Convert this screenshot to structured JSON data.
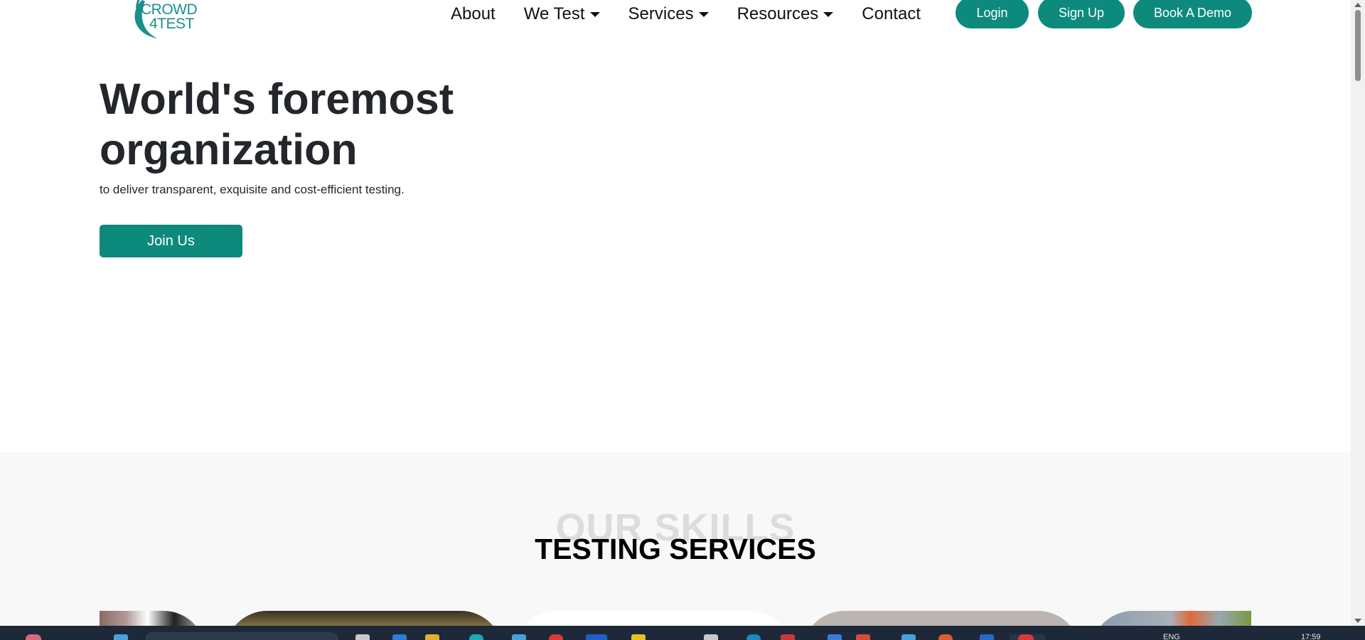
{
  "header": {
    "logo_line1": "CROWD",
    "logo_line2": "4TEST",
    "nav": [
      {
        "label": "About",
        "dropdown": false
      },
      {
        "label": "We Test",
        "dropdown": true
      },
      {
        "label": "Services",
        "dropdown": true
      },
      {
        "label": "Resources",
        "dropdown": true
      },
      {
        "label": "Contact",
        "dropdown": false
      }
    ],
    "login_label": "Login",
    "signup_label": "Sign Up",
    "demo_label": "Book A Demo"
  },
  "hero": {
    "title": "World's foremost organization",
    "subtitle": "to deliver transparent, exquisite and cost-efficient testing.",
    "cta_label": "Join Us"
  },
  "skills": {
    "background_text": "OUR SKILLS",
    "title": "TESTING SERVICES"
  },
  "taskbar": {
    "language": "ENG",
    "time": "17:59"
  },
  "colors": {
    "brand": "#0e8a7c",
    "logo": "#1b8f8a",
    "text": "#23262b",
    "section_bg": "#f8f8f8",
    "taskbar": "#1d2838"
  }
}
